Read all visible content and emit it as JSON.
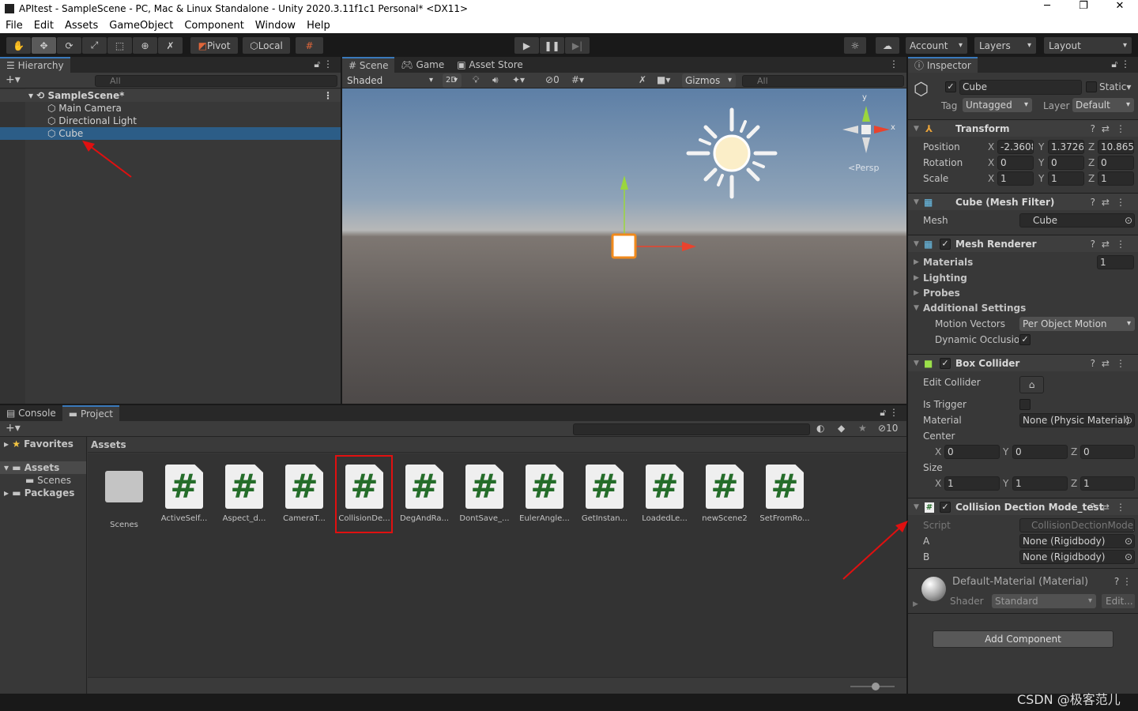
{
  "window": {
    "title": "APItest - SampleScene - PC, Mac & Linux Standalone - Unity 2020.3.11f1c1 Personal* <DX11>",
    "minimize": "─",
    "maximize": "❐",
    "close": "✕"
  },
  "menu": [
    "File",
    "Edit",
    "Assets",
    "GameObject",
    "Component",
    "Window",
    "Help"
  ],
  "toolbar": {
    "pivot": "Pivot",
    "local": "Local",
    "account": "Account",
    "layers": "Layers",
    "layout": "Layout"
  },
  "hierarchy": {
    "tab": "Hierarchy",
    "search_placeholder": "All",
    "scene": "SampleScene*",
    "items": [
      "Main Camera",
      "Directional Light",
      "Cube"
    ],
    "selected": "Cube"
  },
  "scene": {
    "tabs": [
      "Scene",
      "Game",
      "Asset Store"
    ],
    "shading": "Shaded",
    "mode_2d": "2D",
    "hidden_count": "0",
    "gizmos": "Gizmos",
    "search_placeholder": "All",
    "persp": "Persp",
    "axis_x": "x",
    "axis_y": "y"
  },
  "inspector": {
    "tab": "Inspector",
    "name": "Cube",
    "active": true,
    "static": "Static",
    "tag_label": "Tag",
    "tag": "Untagged",
    "layer_label": "Layer",
    "layer": "Default",
    "transform": {
      "title": "Transform",
      "position_label": "Position",
      "rotation_label": "Rotation",
      "scale_label": "Scale",
      "position": [
        "-2.3608",
        "1.37265",
        "10.8657"
      ],
      "rotation": [
        "0",
        "0",
        "0"
      ],
      "scale": [
        "1",
        "1",
        "1"
      ]
    },
    "mesh_filter": {
      "title": "Cube (Mesh Filter)",
      "mesh_label": "Mesh",
      "mesh": "Cube"
    },
    "mesh_renderer": {
      "title": "Mesh Renderer",
      "materials": "Materials",
      "materials_count": "1",
      "lighting": "Lighting",
      "probes": "Probes",
      "additional": "Additional Settings",
      "motion_vectors_label": "Motion Vectors",
      "motion_vectors": "Per Object Motion",
      "dynamic_occlusion_label": "Dynamic Occlusion",
      "dynamic_occlusion": true
    },
    "box_collider": {
      "title": "Box Collider",
      "edit_collider": "Edit Collider",
      "is_trigger": "Is Trigger",
      "material_label": "Material",
      "material": "None (Physic Material)",
      "center_label": "Center",
      "center": [
        "0",
        "0",
        "0"
      ],
      "size_label": "Size",
      "size": [
        "1",
        "1",
        "1"
      ]
    },
    "script": {
      "title": "Collision Dection Mode_test",
      "script_label": "Script",
      "script": "CollisionDectionMode_test",
      "a_label": "A",
      "a": "None (Rigidbody)",
      "b_label": "B",
      "b": "None (Rigidbody)"
    },
    "material": {
      "title": "Default-Material (Material)",
      "shader_label": "Shader",
      "shader": "Standard",
      "edit": "Edit..."
    },
    "add_component": "Add Component"
  },
  "bottom": {
    "tabs": [
      "Console",
      "Project"
    ],
    "favorites": "Favorites",
    "assets": "Assets",
    "scenes": "Scenes",
    "packages": "Packages",
    "breadcrumb": "Assets",
    "hidden_count": "10",
    "items": [
      {
        "name": "Scenes",
        "type": "folder"
      },
      {
        "name": "ActiveSelf...",
        "type": "script"
      },
      {
        "name": "Aspect_d...",
        "type": "script"
      },
      {
        "name": "CameraT...",
        "type": "script"
      },
      {
        "name": "CollisionDe...",
        "type": "script",
        "highlighted": true
      },
      {
        "name": "DegAndRa...",
        "type": "script"
      },
      {
        "name": "DontSave_...",
        "type": "script"
      },
      {
        "name": "EulerAngle...",
        "type": "script"
      },
      {
        "name": "GetInstan...",
        "type": "script"
      },
      {
        "name": "LoadedLe...",
        "type": "script"
      },
      {
        "name": "newScene2",
        "type": "script"
      },
      {
        "name": "SetFromRo...",
        "type": "script"
      }
    ]
  },
  "watermark": "CSDN @极客范儿",
  "colors": {
    "selection": "#2c5d87",
    "annotation": "#e01010",
    "script_icon": "#256d2a"
  }
}
